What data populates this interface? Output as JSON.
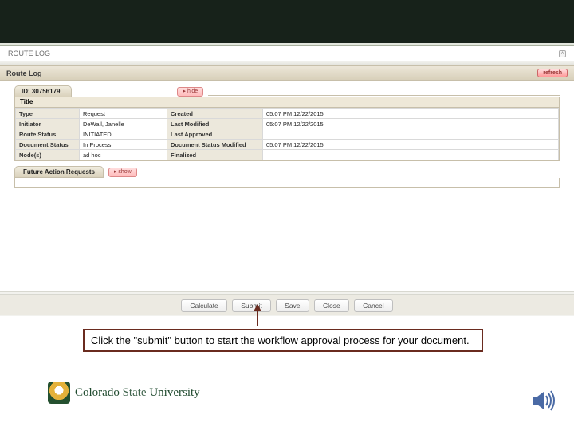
{
  "section": {
    "label": "ROUTE LOG"
  },
  "panel": {
    "title": "Route Log",
    "refresh": "refresh",
    "id_tab": "ID: 30756179",
    "hide": "▸ hide",
    "show": "▸ show",
    "sub_header": "Title",
    "rows": [
      {
        "l1": "Type",
        "v1": "Request",
        "l2": "Created",
        "v2": "05:07 PM 12/22/2015"
      },
      {
        "l1": "Initiator",
        "v1": "DeWall, Janelle",
        "l2": "Last Modified",
        "v2": "05:07 PM 12/22/2015"
      },
      {
        "l1": "Route Status",
        "v1": "INITIATED",
        "l2": "Last Approved",
        "v2": ""
      },
      {
        "l1": "Document Status",
        "v1": "In Process",
        "l2": "Document Status Modified",
        "v2": "05:07 PM 12/22/2015"
      },
      {
        "l1": "Node(s)",
        "v1": "ad hoc",
        "l2": "Finalized",
        "v2": ""
      }
    ],
    "future_tab": "Future Action Requests"
  },
  "buttons": {
    "calculate": "Calculate",
    "submit": "Submit",
    "save": "Save",
    "close": "Close",
    "cancel": "Cancel"
  },
  "callout": "Click the \"submit\" button to start the workflow approval process for your document.",
  "logo": {
    "a": "Colorado",
    "b": "State",
    "c": "University"
  }
}
